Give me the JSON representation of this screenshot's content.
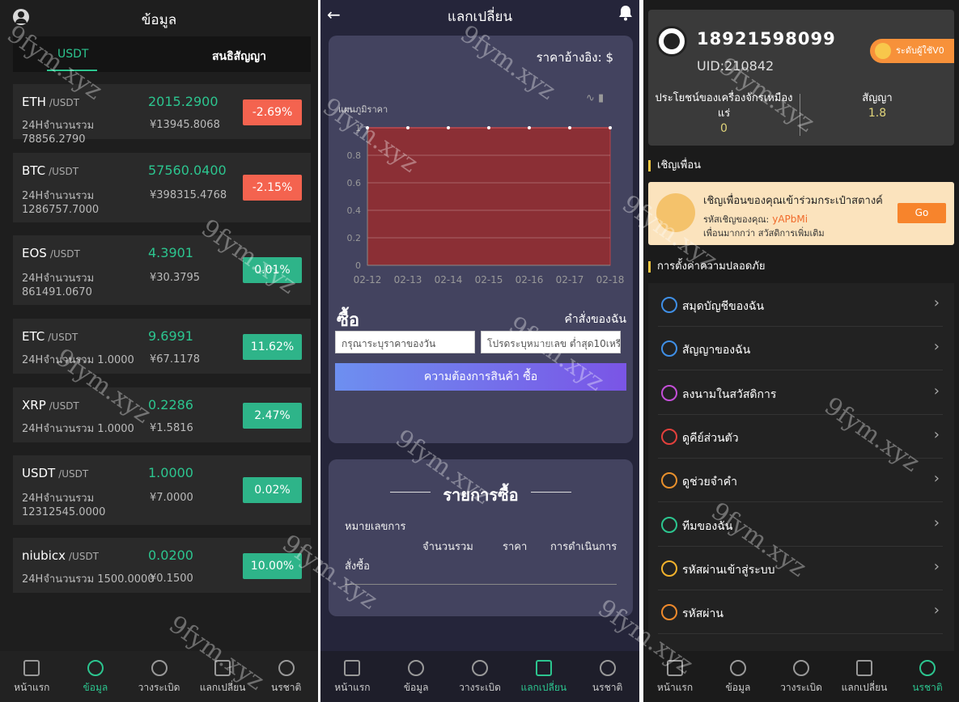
{
  "market": {
    "title": "ข้อมูล",
    "tabs": [
      "USDT",
      "สนธิสัญญา"
    ],
    "coins": [
      {
        "name": "ETH",
        "pair": "/USDT",
        "price": "2015.2900",
        "volume": "24Hจำนวนรวม 78856.2790",
        "cny": "¥13945.8068",
        "change": "-2.69%",
        "dir": "down"
      },
      {
        "name": "BTC",
        "pair": "/USDT",
        "price": "57560.0400",
        "volume": "24Hจำนวนรวม 1286757.7000",
        "cny": "¥398315.4768",
        "change": "-2.15%",
        "dir": "down"
      },
      {
        "name": "EOS",
        "pair": "/USDT",
        "price": "4.3901",
        "volume": "24Hจำนวนรวม 861491.0670",
        "cny": "¥30.3795",
        "change": "0.01%",
        "dir": "up"
      },
      {
        "name": "ETC",
        "pair": "/USDT",
        "price": "9.6991",
        "volume": "24Hจำนวนรวม 1.0000",
        "cny": "¥67.1178",
        "change": "11.62%",
        "dir": "up"
      },
      {
        "name": "XRP",
        "pair": "/USDT",
        "price": "0.2286",
        "volume": "24Hจำนวนรวม 1.0000",
        "cny": "¥1.5816",
        "change": "2.47%",
        "dir": "up"
      },
      {
        "name": "USDT",
        "pair": "/USDT",
        "price": "1.0000",
        "volume": "24Hจำนวนรวม 12312545.0000",
        "cny": "¥7.0000",
        "change": "0.02%",
        "dir": "up"
      },
      {
        "name": "niubicx",
        "pair": "/USDT",
        "price": "0.0200",
        "volume": "24Hจำนวนรวม 1500.0000",
        "cny": "¥0.1500",
        "change": "10.00%",
        "dir": "up"
      }
    ]
  },
  "nav": [
    "หน้าแรก",
    "ข้อมูล",
    "วางระเบิด",
    "แลกเปลี่ยน",
    "นรชาติ"
  ],
  "exchange": {
    "title": "แลกเปลี่ยน",
    "ref_price": "ราคาอ้างอิง: $",
    "chart_title": "แผนภูมิราคา",
    "buy_label": "ซื้อ",
    "my_orders": "คำสั่งของฉัน",
    "price_placeholder": "กรุณาระบุราคาของวัน",
    "qty_placeholder": "โปรดระบุหมายเลข ต่ำสุด10เหรียญ",
    "buy_button": "ความต้องการสินค้า ซื้อ",
    "orders_title": "รายการซื้อ",
    "col_order_no": "หมายเลขการ",
    "col_order_no2": "สั่งซื้อ",
    "col_qty": "จำนวนรวม",
    "col_price": "ราคา",
    "col_action": "การดำเนินการ"
  },
  "chart_data": {
    "type": "area",
    "title": "แผนภูมิราคา",
    "categories": [
      "02-12",
      "02-13",
      "02-14",
      "02-15",
      "02-16",
      "02-17",
      "02-18"
    ],
    "values": [
      1,
      1,
      1,
      1,
      1,
      1,
      1
    ],
    "yticks": [
      "0",
      "0.2",
      "0.4",
      "0.6",
      "0.8",
      "1"
    ],
    "ylim": [
      0,
      1
    ],
    "grid": true,
    "fill_color": "#8b2f35"
  },
  "profile": {
    "phone": "18921598099",
    "uid": "UID:210842",
    "level": "ระดับผู้ใช้V0",
    "stat1_label": "ประโยชน์ของเครื่องจักรเหมือง แร่",
    "stat1_value": "0",
    "stat2_label": "สัญญา",
    "stat2_value": "1.8",
    "invite_section": "เชิญเพื่อน",
    "invite_text": "เชิญเพื่อนของคุณเข้าร่วมกระเป๋าสตางค์",
    "invite_code_label": "รหัสเชิญของคุณ:",
    "invite_code": "yAPbMi",
    "invite_more": "เพื่อนมากกว่า สวัสดิการเพิ่มเติม",
    "go": "Go",
    "security_section": "การตั้งค่าความปลอดภัย",
    "menu": [
      "สมุดบัญชีของฉัน",
      "สัญญาของฉัน",
      "ลงนามในสวัสดิการ",
      "ดูคีย์ส่วนตัว",
      "ดูช่วยจำคำ",
      "ทีมของฉัน",
      "รหัสผ่านเข้าสู่ระบบ",
      "รหัสผ่าน"
    ]
  },
  "watermark": "9fym.xyz",
  "colors": {
    "up": "#2eb489",
    "down": "#f4634f",
    "accent": "#2cc58f"
  }
}
